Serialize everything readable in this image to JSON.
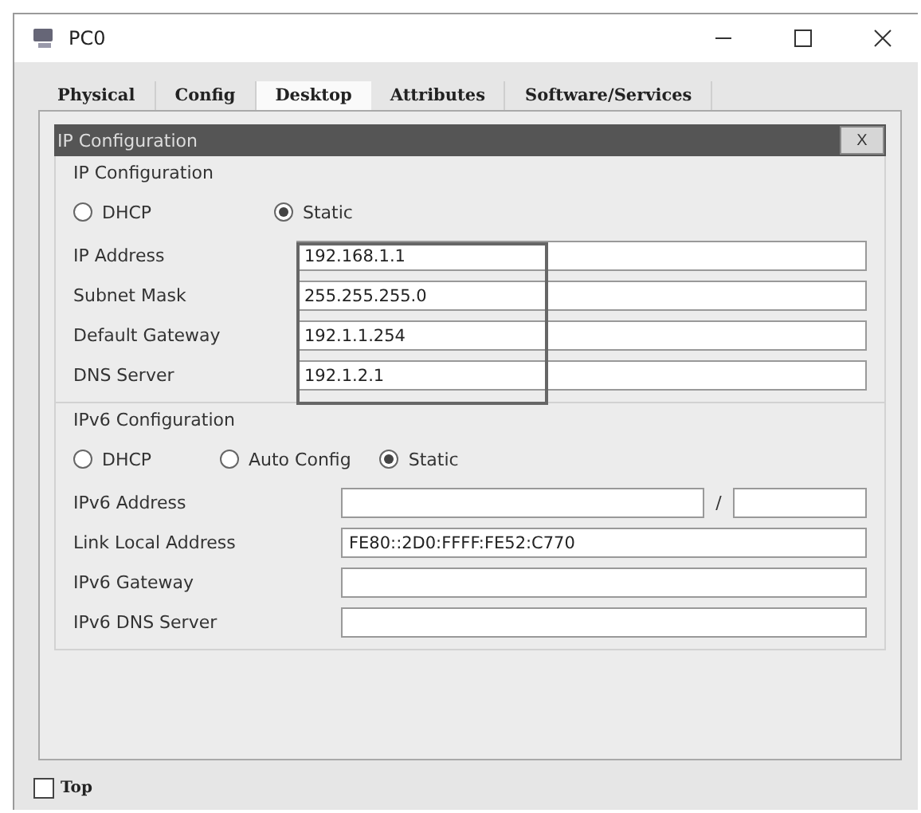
{
  "window": {
    "title": "PC0"
  },
  "tabs": [
    {
      "label": "Physical",
      "selected": false
    },
    {
      "label": "Config",
      "selected": false
    },
    {
      "label": "Desktop",
      "selected": true
    },
    {
      "label": "Attributes",
      "selected": false
    },
    {
      "label": "Software/Services",
      "selected": false
    }
  ],
  "dialog": {
    "title": "IP Configuration",
    "close": "X"
  },
  "ipv4": {
    "heading": "IP Configuration",
    "modes": [
      {
        "label": "DHCP",
        "selected": false
      },
      {
        "label": "Static",
        "selected": true
      }
    ],
    "fields": [
      {
        "label": "IP Address",
        "value": "192.168.1.1"
      },
      {
        "label": "Subnet Mask",
        "value": "255.255.255.0"
      },
      {
        "label": "Default Gateway",
        "value": "192.1.1.254"
      },
      {
        "label": "DNS Server",
        "value": "192.1.2.1"
      }
    ]
  },
  "ipv6": {
    "heading": "IPv6 Configuration",
    "modes": [
      {
        "label": "DHCP",
        "selected": false
      },
      {
        "label": "Auto Config",
        "selected": false
      },
      {
        "label": "Static",
        "selected": true
      }
    ],
    "fields": [
      {
        "label": "IPv6 Address",
        "kind": "prefix",
        "separator": "/"
      },
      {
        "label": "Link Local Address",
        "kind": "plain",
        "value": "FE80::2D0:FFFF:FE52:C770"
      },
      {
        "label": "IPv6 Gateway",
        "kind": "plain"
      },
      {
        "label": "IPv6 DNS Server",
        "kind": "plain"
      }
    ]
  },
  "top": {
    "label": "Top",
    "checked": false
  }
}
